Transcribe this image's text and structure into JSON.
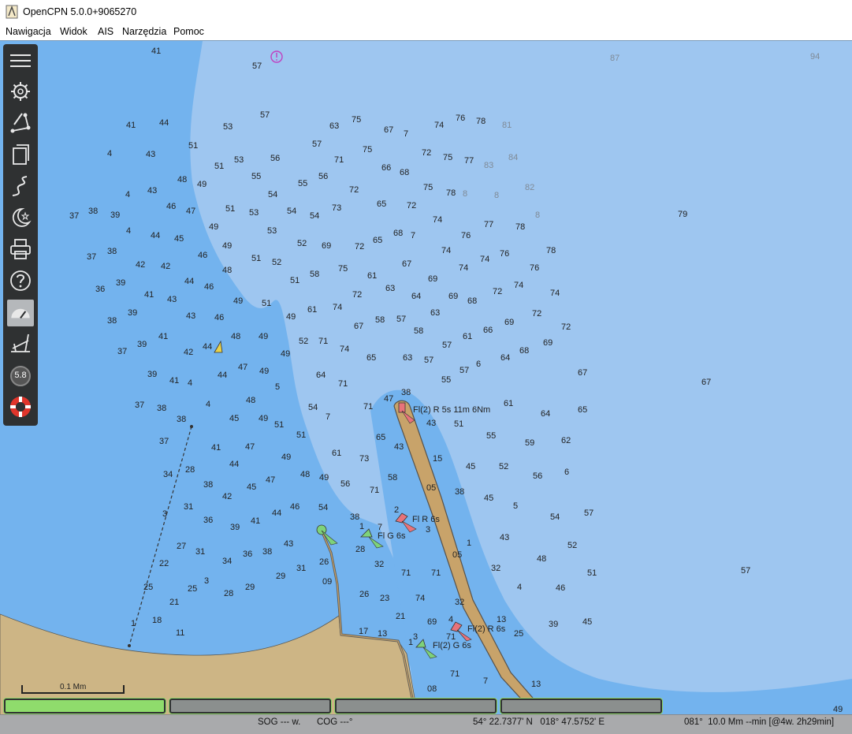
{
  "window": {
    "title": "OpenCPN 5.0.0+9065270"
  },
  "menu": {
    "items": [
      "Nawigacja",
      "Widok",
      "AIS",
      "Narzędzia",
      "Pomoc"
    ]
  },
  "toolbar": {
    "items": [
      "menu-icon",
      "settings-icon",
      "route-icon",
      "layers-icon",
      "track-icon",
      "night-mode-icon",
      "print-icon",
      "help-icon",
      "dashboard-icon",
      "tide-icon",
      "zoom-indicator-icon",
      "mob-icon"
    ],
    "zoom_label": "5.8"
  },
  "chart": {
    "colors": {
      "deep": "#9ec6f0",
      "mid": "#73b3ee",
      "land": "#cdb585",
      "pier": "#c8a36a",
      "light_red": "#e8737a",
      "light_green": "#7ed27a"
    },
    "depth_soundings": [
      [
        "41",
        192,
        63
      ],
      [
        "57",
        320,
        82
      ],
      [
        "87",
        774,
        72
      ],
      [
        "94",
        1028,
        70
      ],
      [
        "41",
        160,
        157
      ],
      [
        "44",
        202,
        154
      ],
      [
        "53",
        283,
        159
      ],
      [
        "57",
        330,
        144
      ],
      [
        "63",
        418,
        158
      ],
      [
        "75",
        446,
        150
      ],
      [
        "67",
        487,
        163
      ],
      [
        "7",
        512,
        168
      ],
      [
        "74",
        551,
        157
      ],
      [
        "76",
        578,
        148
      ],
      [
        "78",
        604,
        152
      ],
      [
        "81",
        637,
        157
      ],
      [
        "4",
        136,
        193
      ],
      [
        "43",
        185,
        194
      ],
      [
        "51",
        239,
        183
      ],
      [
        "51",
        272,
        209
      ],
      [
        "53",
        297,
        201
      ],
      [
        "56",
        343,
        199
      ],
      [
        "57",
        396,
        181
      ],
      [
        "71",
        424,
        201
      ],
      [
        "75",
        460,
        188
      ],
      [
        "72",
        535,
        192
      ],
      [
        "75",
        562,
        198
      ],
      [
        "77",
        589,
        202
      ],
      [
        "83",
        614,
        208
      ],
      [
        "84",
        645,
        198
      ],
      [
        "48",
        225,
        226
      ],
      [
        "49",
        250,
        232
      ],
      [
        "55",
        319,
        222
      ],
      [
        "55",
        378,
        231
      ],
      [
        "56",
        404,
        222
      ],
      [
        "66",
        484,
        211
      ],
      [
        "68",
        507,
        217
      ],
      [
        "75",
        537,
        236
      ],
      [
        "78",
        566,
        243
      ],
      [
        "8",
        587,
        244
      ],
      [
        "8",
        627,
        246
      ],
      [
        "82",
        666,
        236
      ],
      [
        "4",
        159,
        245
      ],
      [
        "43",
        187,
        240
      ],
      [
        "54",
        340,
        245
      ],
      [
        "72",
        443,
        239
      ],
      [
        "65",
        478,
        257
      ],
      [
        "72",
        516,
        259
      ],
      [
        "46",
        211,
        260
      ],
      [
        "47",
        236,
        266
      ],
      [
        "51",
        286,
        263
      ],
      [
        "53",
        316,
        268
      ],
      [
        "54",
        364,
        266
      ],
      [
        "54",
        393,
        272
      ],
      [
        "73",
        421,
        262
      ],
      [
        "79",
        860,
        270
      ],
      [
        "37",
        88,
        272
      ],
      [
        "38",
        112,
        266
      ],
      [
        "39",
        140,
        271
      ],
      [
        "8",
        679,
        271
      ],
      [
        "74",
        549,
        277
      ],
      [
        "77",
        614,
        283
      ],
      [
        "78",
        654,
        286
      ],
      [
        "4",
        160,
        291
      ],
      [
        "44",
        191,
        297
      ],
      [
        "45",
        221,
        301
      ],
      [
        "49",
        265,
        286
      ],
      [
        "53",
        339,
        291
      ],
      [
        "68",
        499,
        294
      ],
      [
        "7",
        521,
        297
      ],
      [
        "76",
        585,
        297
      ],
      [
        "52",
        377,
        307
      ],
      [
        "69",
        408,
        310
      ],
      [
        "72",
        450,
        311
      ],
      [
        "65",
        473,
        303
      ],
      [
        "37",
        110,
        324
      ],
      [
        "38",
        136,
        317
      ],
      [
        "46",
        251,
        322
      ],
      [
        "49",
        282,
        310
      ],
      [
        "51",
        319,
        326
      ],
      [
        "52",
        345,
        331
      ],
      [
        "74",
        560,
        316
      ],
      [
        "74",
        609,
        327
      ],
      [
        "76",
        634,
        320
      ],
      [
        "78",
        693,
        316
      ],
      [
        "42",
        172,
        334
      ],
      [
        "42",
        204,
        336
      ],
      [
        "48",
        282,
        341
      ],
      [
        "58",
        393,
        346
      ],
      [
        "75",
        429,
        339
      ],
      [
        "61",
        466,
        348
      ],
      [
        "67",
        510,
        333
      ],
      [
        "74",
        582,
        338
      ],
      [
        "76",
        672,
        338
      ],
      [
        "36",
        121,
        365
      ],
      [
        "39",
        147,
        357
      ],
      [
        "44",
        234,
        355
      ],
      [
        "46",
        259,
        362
      ],
      [
        "51",
        368,
        354
      ],
      [
        "69",
        543,
        352
      ],
      [
        "74",
        652,
        360
      ],
      [
        "41",
        183,
        372
      ],
      [
        "43",
        212,
        378
      ],
      [
        "49",
        296,
        380
      ],
      [
        "51",
        332,
        383
      ],
      [
        "61",
        390,
        391
      ],
      [
        "63",
        489,
        364
      ],
      [
        "64",
        522,
        374
      ],
      [
        "69",
        569,
        374
      ],
      [
        "68",
        593,
        380
      ],
      [
        "72",
        625,
        368
      ],
      [
        "74",
        698,
        370
      ],
      [
        "38",
        136,
        405
      ],
      [
        "39",
        162,
        395
      ],
      [
        "43",
        236,
        399
      ],
      [
        "46",
        272,
        401
      ],
      [
        "72",
        447,
        372
      ],
      [
        "74",
        422,
        388
      ],
      [
        "63",
        546,
        395
      ],
      [
        "49",
        363,
        400
      ],
      [
        "58",
        476,
        404
      ],
      [
        "57",
        503,
        403
      ],
      [
        "67",
        449,
        412
      ],
      [
        "58",
        525,
        418
      ],
      [
        "66",
        613,
        417
      ],
      [
        "69",
        640,
        407
      ],
      [
        "72",
        675,
        396
      ],
      [
        "72",
        712,
        413
      ],
      [
        "41",
        201,
        425
      ],
      [
        "48",
        293,
        425
      ],
      [
        "49",
        328,
        425
      ],
      [
        "52",
        379,
        431
      ],
      [
        "71",
        404,
        431
      ],
      [
        "74",
        431,
        441
      ],
      [
        "61",
        587,
        425
      ],
      [
        "37",
        149,
        444
      ],
      [
        "39",
        174,
        435
      ],
      [
        "42",
        233,
        445
      ],
      [
        "44",
        257,
        438
      ],
      [
        "49",
        356,
        447
      ],
      [
        "65",
        465,
        452
      ],
      [
        "63",
        511,
        452
      ],
      [
        "57",
        538,
        455
      ],
      [
        "57",
        561,
        436
      ],
      [
        "69",
        689,
        433
      ],
      [
        "68",
        659,
        443
      ],
      [
        "64",
        635,
        452
      ],
      [
        "6",
        604,
        460
      ],
      [
        "47",
        302,
        464
      ],
      [
        "39",
        187,
        473
      ],
      [
        "41",
        215,
        481
      ],
      [
        "4",
        238,
        484
      ],
      [
        "44",
        276,
        474
      ],
      [
        "49",
        329,
        469
      ],
      [
        "64",
        401,
        474
      ],
      [
        "71",
        429,
        485
      ],
      [
        "57",
        583,
        468
      ],
      [
        "55",
        560,
        480
      ],
      [
        "67",
        733,
        471
      ],
      [
        "67",
        890,
        483
      ],
      [
        "5",
        349,
        489
      ],
      [
        "47",
        487,
        504
      ],
      [
        "38",
        509,
        496
      ],
      [
        "48",
        312,
        506
      ],
      [
        "37",
        171,
        512
      ],
      [
        "38",
        199,
        516
      ],
      [
        "4",
        261,
        511
      ],
      [
        "54",
        391,
        515
      ],
      [
        "7",
        413,
        527
      ],
      [
        "71",
        461,
        514
      ],
      [
        "61",
        639,
        510
      ],
      [
        "64",
        686,
        523
      ],
      [
        "65",
        733,
        518
      ],
      [
        "38",
        224,
        530
      ],
      [
        "45",
        291,
        529
      ],
      [
        "49",
        328,
        529
      ],
      [
        "51",
        348,
        537
      ],
      [
        "43",
        541,
        535
      ],
      [
        "51",
        576,
        536
      ],
      [
        "55",
        617,
        551
      ],
      [
        "59",
        666,
        560
      ],
      [
        "62",
        712,
        557
      ],
      [
        "37",
        202,
        558
      ],
      [
        "41",
        268,
        566
      ],
      [
        "47",
        311,
        565
      ],
      [
        "51",
        376,
        550
      ],
      [
        "65",
        477,
        553
      ],
      [
        "43",
        500,
        565
      ],
      [
        "34",
        207,
        600
      ],
      [
        "28",
        235,
        594
      ],
      [
        "44",
        291,
        587
      ],
      [
        "49",
        357,
        578
      ],
      [
        "61",
        421,
        573
      ],
      [
        "73",
        456,
        580
      ],
      [
        "15",
        549,
        580
      ],
      [
        "45",
        591,
        590
      ],
      [
        "52",
        633,
        590
      ],
      [
        "48",
        381,
        600
      ],
      [
        "49",
        405,
        604
      ],
      [
        "56",
        432,
        612
      ],
      [
        "58",
        492,
        604
      ],
      [
        "56",
        676,
        602
      ],
      [
        "6",
        716,
        597
      ],
      [
        "38",
        258,
        613
      ],
      [
        "42",
        282,
        628
      ],
      [
        "45",
        313,
        616
      ],
      [
        "47",
        337,
        607
      ],
      [
        "71",
        469,
        620
      ],
      [
        "05",
        541,
        617
      ],
      [
        "38",
        577,
        622
      ],
      [
        "45",
        614,
        630
      ],
      [
        "5",
        651,
        640
      ],
      [
        "31",
        233,
        641
      ],
      [
        "54",
        404,
        642
      ],
      [
        "46",
        368,
        641
      ],
      [
        "57",
        741,
        649
      ],
      [
        "54",
        698,
        654
      ],
      [
        "3",
        206,
        650
      ],
      [
        "36",
        258,
        658
      ],
      [
        "39",
        292,
        667
      ],
      [
        "41",
        318,
        659
      ],
      [
        "44",
        345,
        649
      ],
      [
        "38",
        444,
        654
      ],
      [
        "2",
        500,
        645
      ],
      [
        "3",
        540,
        670
      ],
      [
        "1",
        456,
        666
      ],
      [
        "7",
        479,
        667
      ],
      [
        "43",
        634,
        680
      ],
      [
        "1",
        592,
        687
      ],
      [
        "52",
        720,
        690
      ],
      [
        "27",
        224,
        691
      ],
      [
        "31",
        248,
        698
      ],
      [
        "34",
        282,
        710
      ],
      [
        "36",
        308,
        701
      ],
      [
        "38",
        333,
        698
      ],
      [
        "43",
        360,
        688
      ],
      [
        "28",
        451,
        695
      ],
      [
        "05",
        574,
        702
      ],
      [
        "48",
        681,
        707
      ],
      [
        "51",
        745,
        725
      ],
      [
        "57",
        940,
        722
      ],
      [
        "22",
        202,
        713
      ],
      [
        "26",
        405,
        711
      ],
      [
        "32",
        475,
        714
      ],
      [
        "71",
        509,
        725
      ],
      [
        "71",
        547,
        725
      ],
      [
        "32",
        623,
        719
      ],
      [
        "3",
        259,
        735
      ],
      [
        "25",
        238,
        745
      ],
      [
        "28",
        284,
        751
      ],
      [
        "29",
        311,
        743
      ],
      [
        "31",
        376,
        719
      ],
      [
        "29",
        350,
        729
      ],
      [
        "09",
        409,
        736
      ],
      [
        "46",
        705,
        744
      ],
      [
        "4",
        656,
        743
      ],
      [
        "25",
        182,
        743
      ],
      [
        "21",
        215,
        762
      ],
      [
        "26",
        456,
        752
      ],
      [
        "23",
        482,
        757
      ],
      [
        "74",
        527,
        757
      ],
      [
        "32",
        577,
        762
      ],
      [
        "18",
        193,
        785
      ],
      [
        "11",
        223,
        801
      ],
      [
        "1",
        166,
        789
      ],
      [
        "21",
        502,
        780
      ],
      [
        "69",
        542,
        787
      ],
      [
        "4",
        569,
        784
      ],
      [
        "13",
        630,
        784
      ],
      [
        "39",
        696,
        790
      ],
      [
        "45",
        739,
        787
      ],
      [
        "17",
        455,
        799
      ],
      [
        "13",
        479,
        802
      ],
      [
        "3",
        524,
        806
      ],
      [
        "1",
        518,
        813
      ],
      [
        "71",
        566,
        806
      ],
      [
        "25",
        652,
        802
      ],
      [
        "71",
        571,
        853
      ],
      [
        "7",
        613,
        862
      ],
      [
        "08",
        542,
        872
      ],
      [
        "13",
        674,
        866
      ],
      [
        "49",
        1057,
        898
      ]
    ],
    "lights": [
      {
        "text": "Fl(2) R 5s 11m 6Nm"
      },
      {
        "text": "Fl R 6s"
      },
      {
        "text": "Fl G 6s"
      },
      {
        "text": "Fl(2) R 6s"
      },
      {
        "text": "Fl(2) G 6s"
      }
    ],
    "scale_label": "0.1 Mm"
  },
  "stats": {
    "boxes": [
      "stat-box-1",
      "stat-box-2",
      "stat-box-3",
      "stat-box-4"
    ]
  },
  "status": {
    "sog": "SOG --- w.",
    "cog": "COG ---°",
    "position": "54° 22.7377' N   018° 47.5752' E",
    "cursor": "081°  10.0 Mm --min [@4w. 2h29min]"
  }
}
